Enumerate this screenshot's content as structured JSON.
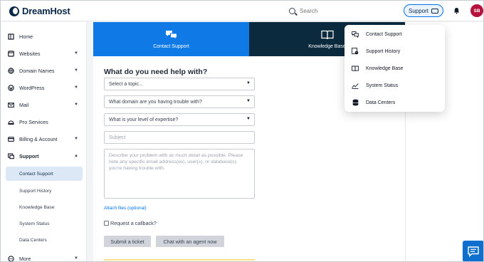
{
  "brand": {
    "name": "DreamHost"
  },
  "search": {
    "placeholder": "Search"
  },
  "header": {
    "support_label": "Support",
    "avatar_initials": "SB"
  },
  "sidebar": {
    "items": [
      {
        "label": "Home",
        "icon": "home-icon",
        "caret": false
      },
      {
        "label": "Websites",
        "icon": "globe-window-icon",
        "caret": true
      },
      {
        "label": "Domain Names",
        "icon": "globe-icon",
        "caret": true
      },
      {
        "label": "WordPress",
        "icon": "wordpress-icon",
        "caret": true
      },
      {
        "label": "Mail",
        "icon": "mail-icon",
        "caret": true
      },
      {
        "label": "Pro Services",
        "icon": "pro-services-icon",
        "caret": false
      },
      {
        "label": "Billing & Account",
        "icon": "billing-icon",
        "caret": true
      },
      {
        "label": "Support",
        "icon": "support-icon",
        "caret": true,
        "expanded": true
      }
    ],
    "support_sub": [
      {
        "label": "Contact Support",
        "active": true
      },
      {
        "label": "Support History",
        "active": false
      },
      {
        "label": "Knowledge Base",
        "active": false
      },
      {
        "label": "System Status",
        "active": false
      },
      {
        "label": "Data Centers",
        "active": false
      }
    ],
    "more_label": "More"
  },
  "tabs": {
    "contact": "Contact Support",
    "kb": "Knowledge Base"
  },
  "form": {
    "heading": "What do you need help with?",
    "topic": "Select a topic...",
    "domain": "What domain are you having trouble with?",
    "expertise": "What is your level of expertise?",
    "subject_placeholder": "Subject",
    "description_placeholder": "Describe your problem with as much detail as possible. Please note any specific email address(es), user(s), or database(s) you're having trouble with.",
    "attach_label": "Attach files (optional)",
    "callback_label": "Request a callback?",
    "submit_label": "Submit a ticket",
    "chat_label": "Chat with an agent now"
  },
  "dropdown": {
    "items": [
      {
        "label": "Contact Support",
        "icon": "chat-bubbles-icon"
      },
      {
        "label": "Support History",
        "icon": "history-icon"
      },
      {
        "label": "Knowledge Base",
        "icon": "book-icon"
      },
      {
        "label": "System Status",
        "icon": "activity-chart-icon"
      },
      {
        "label": "Data Centers",
        "icon": "database-icon"
      }
    ]
  },
  "colors": {
    "accent": "#0f7ae5",
    "dark_tab": "#0b2a3e",
    "avatar": "#b4123c",
    "active_nav": "#dde8f7"
  }
}
